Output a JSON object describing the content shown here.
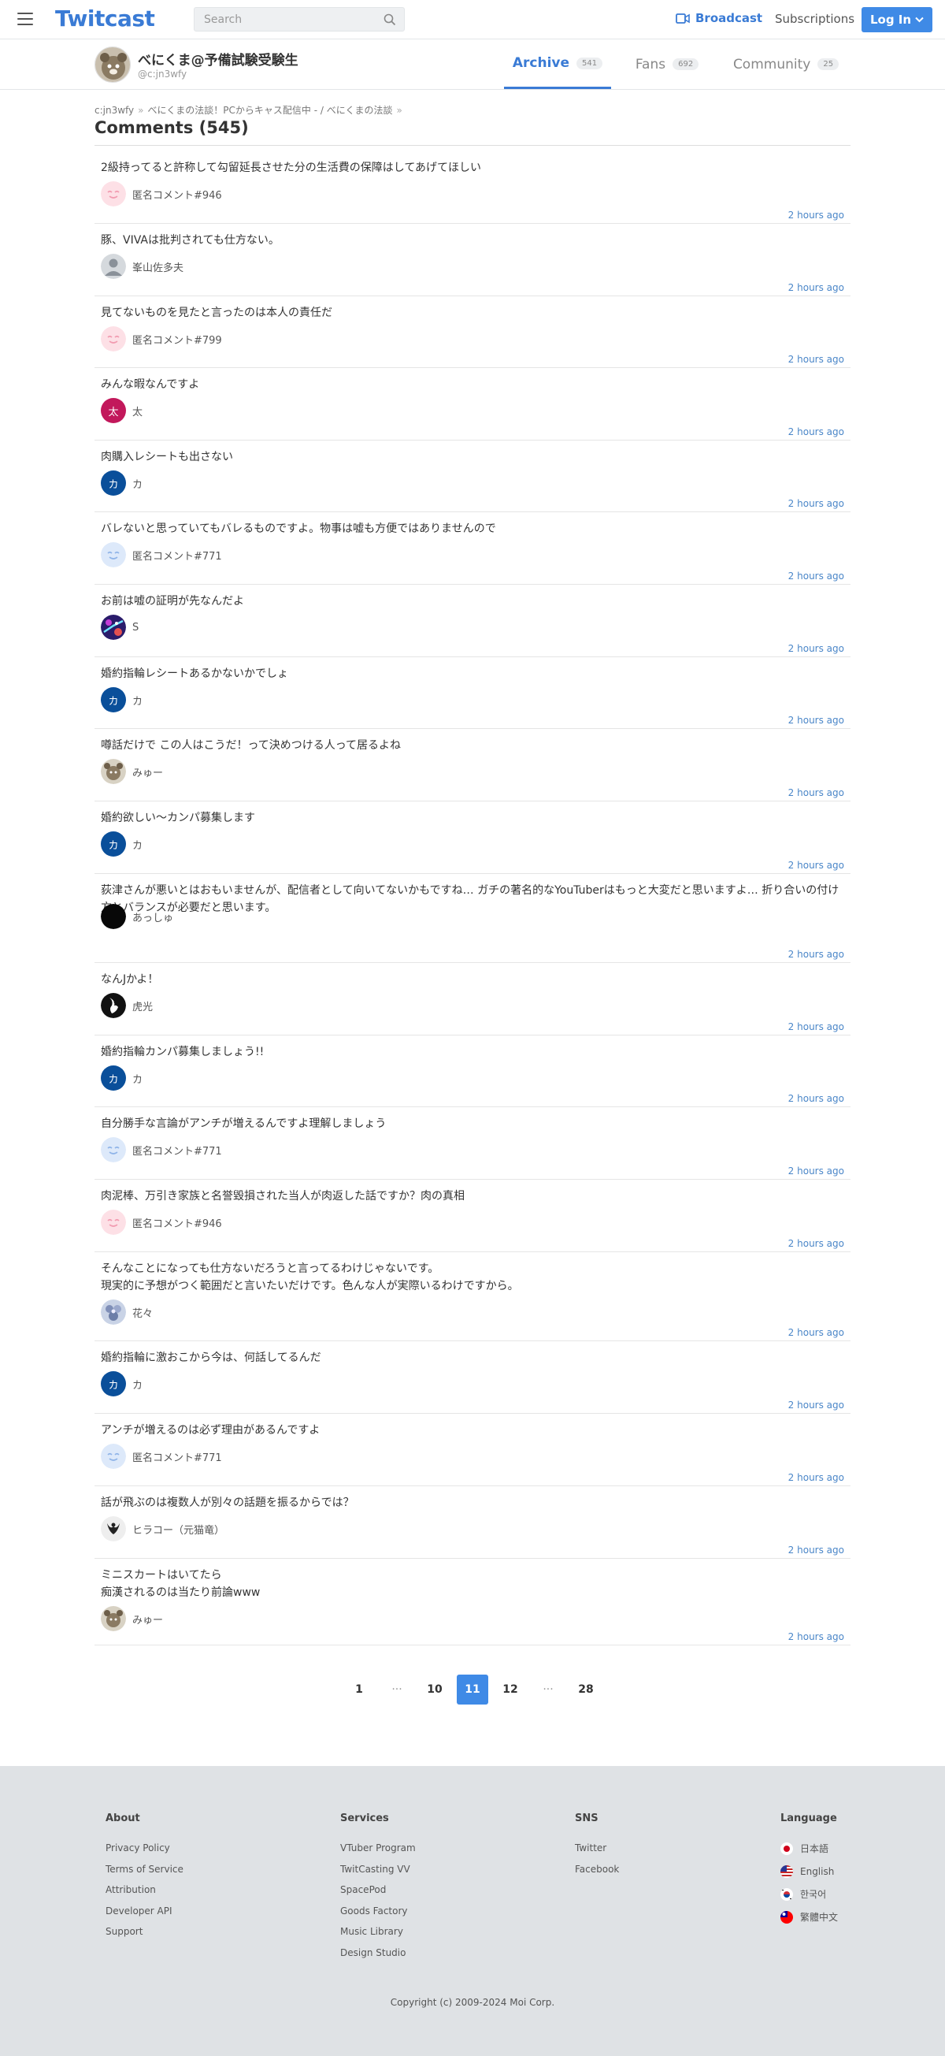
{
  "header": {
    "logo": "Twitcast",
    "search_placeholder": "Search",
    "broadcast_label": "Broadcast",
    "subscriptions_label": "Subscriptions",
    "login_label": "Log In"
  },
  "profile": {
    "name": "べにくま@予備試験受験生",
    "handle": "@c:jn3wfy",
    "tabs": [
      {
        "label": "Archive",
        "count": "541",
        "active": true
      },
      {
        "label": "Fans",
        "count": "692",
        "active": false
      },
      {
        "label": "Community",
        "count": "25",
        "active": false
      }
    ]
  },
  "breadcrumb": [
    "c:jn3wfy",
    "べにくまの法談！PCからキャス配信中 - / べにくまの法談"
  ],
  "page_title": "Comments (545)",
  "comments": [
    {
      "text": "2級持ってると許称して勾留延長させた分の生活費の保障はしてあげてほしい",
      "user": "匿名コメント#946",
      "avatar": "anon-pink-icon",
      "time": "2 hours ago"
    },
    {
      "text": "豚、VIVAは批判されても仕方ない。",
      "user": "峯山佐多夫",
      "avatar": "default-user-icon",
      "time": "2 hours ago"
    },
    {
      "text": "見てないものを見たと言ったのは本人の責任だ",
      "user": "匿名コメント#799",
      "avatar": "anon-pink-icon",
      "time": "2 hours ago"
    },
    {
      "text": "みんな暇なんですよ",
      "user": "太",
      "avatar": "futoshi-letter-icon",
      "avatar_char": "太",
      "time": "2 hours ago"
    },
    {
      "text": "肉購入レシートも出さない",
      "user": "カ",
      "avatar": "kana-letter-icon",
      "avatar_char": "カ",
      "time": "2 hours ago"
    },
    {
      "text": "バレないと思っていてもバレるものですよ。物事は嘘も方便ではありませんので",
      "user": "匿名コメント#771",
      "avatar": "anon-blue-icon",
      "time": "2 hours ago"
    },
    {
      "text": "お前は嘘の証明が先なんだよ",
      "user": "S",
      "avatar": "galaxy-photo-icon",
      "time": "2 hours ago"
    },
    {
      "text": "婚約指輪レシートあるかないかでしょ",
      "user": "カ",
      "avatar": "kana-letter-icon",
      "avatar_char": "カ",
      "time": "2 hours ago"
    },
    {
      "text": "噂話だけで この人はこうだ！って決めつける人って居るよね",
      "user": "みゅー",
      "avatar": "character-photo-icon",
      "time": "2 hours ago"
    },
    {
      "text": "婚約󠄀欲しい〜カンパ募集します",
      "user": "カ",
      "avatar": "kana-letter-icon",
      "avatar_char": "カ",
      "time": "2 hours ago"
    },
    {
      "text": "荻津さんが悪いとはおもいませんが、配信者として向いてないかもですね… ガチの著名的なYouTuberはもっと大変だと思いますよ… 折り合いの付け方とバランスが必要だと思います。",
      "user": "あっしゅ",
      "avatar": "black-circle-icon",
      "time": "2 hours ago"
    },
    {
      "text": "なんJかよ！",
      "user": "虎光",
      "avatar": "tiger-emblem-icon",
      "time": "2 hours ago"
    },
    {
      "text": "婚約指輪カンパ募集しましょう!!",
      "user": "カ",
      "avatar": "kana-letter-icon",
      "avatar_char": "カ",
      "time": "2 hours ago"
    },
    {
      "text": "自分勝手な言論がアンチが増えるんですよ理解しましょう",
      "user": "匿名コメント#771",
      "avatar": "anon-blue-icon",
      "time": "2 hours ago"
    },
    {
      "text": "肉泥棒、万引き家族と名誉毀損された当人が肉返した話ですか？肉の真相",
      "user": "匿名コメント#946",
      "avatar": "anon-pink-icon",
      "time": "2 hours ago"
    },
    {
      "text": "そんなことになっても仕方ないだろうと言ってるわけじゃないです。\n現実的に予想がつく範囲だと言いたいだけです。色んな人が実際いるわけですから。",
      "user": "花々",
      "avatar": "flower-photo-icon",
      "time": "2 hours ago"
    },
    {
      "text": "婚約指輪に激おこから今は、何話してるんだ",
      "user": "カ",
      "avatar": "kana-letter-icon",
      "avatar_char": "カ",
      "time": "2 hours ago"
    },
    {
      "text": "アンチが増えるのは必ず理由があるんですよ",
      "user": "匿名コメント#771",
      "avatar": "anon-blue-icon",
      "time": "2 hours ago"
    },
    {
      "text": "話が飛ぶのは複数人が別々の話題を振るからでは？",
      "user": "ヒラコー（元猫竜）",
      "avatar": "crest-photo-icon",
      "time": "2 hours ago"
    },
    {
      "text": "ミニスカートはいてたら\n痴漢されるのは当たり前論www",
      "user": "みゅー",
      "avatar": "character-photo-icon",
      "time": "2 hours ago"
    }
  ],
  "pagination": [
    {
      "label": "1",
      "type": "page"
    },
    {
      "label": "···",
      "type": "dots"
    },
    {
      "label": "10",
      "type": "page"
    },
    {
      "label": "11",
      "type": "current"
    },
    {
      "label": "12",
      "type": "page"
    },
    {
      "label": "···",
      "type": "dots"
    },
    {
      "label": "28",
      "type": "page"
    }
  ],
  "footer": {
    "about": {
      "heading": "About",
      "links": [
        "Privacy Policy",
        "Terms of Service",
        "Attribution",
        "Developer API",
        "Support"
      ]
    },
    "services": {
      "heading": "Services",
      "links": [
        "VTuber Program",
        "TwitCasting VV",
        "SpacePod",
        "Goods Factory",
        "Music Library",
        "Design Studio"
      ]
    },
    "sns": {
      "heading": "SNS",
      "links": [
        "Twitter",
        "Facebook"
      ]
    },
    "language": {
      "heading": "Language",
      "items": [
        {
          "label": "日本語",
          "flag": "japan-flag-icon"
        },
        {
          "label": "English",
          "flag": "us-flag-icon"
        },
        {
          "label": "한국어",
          "flag": "korea-flag-icon"
        },
        {
          "label": "繁體中文",
          "flag": "taiwan-flag-icon"
        }
      ]
    },
    "copyright": "Copyright (c) 2009-2024 Moi Corp."
  },
  "colors": {
    "accent": "#3f8ae6",
    "link": "#4a86c8",
    "footer_bg": "#dfe2e5"
  }
}
